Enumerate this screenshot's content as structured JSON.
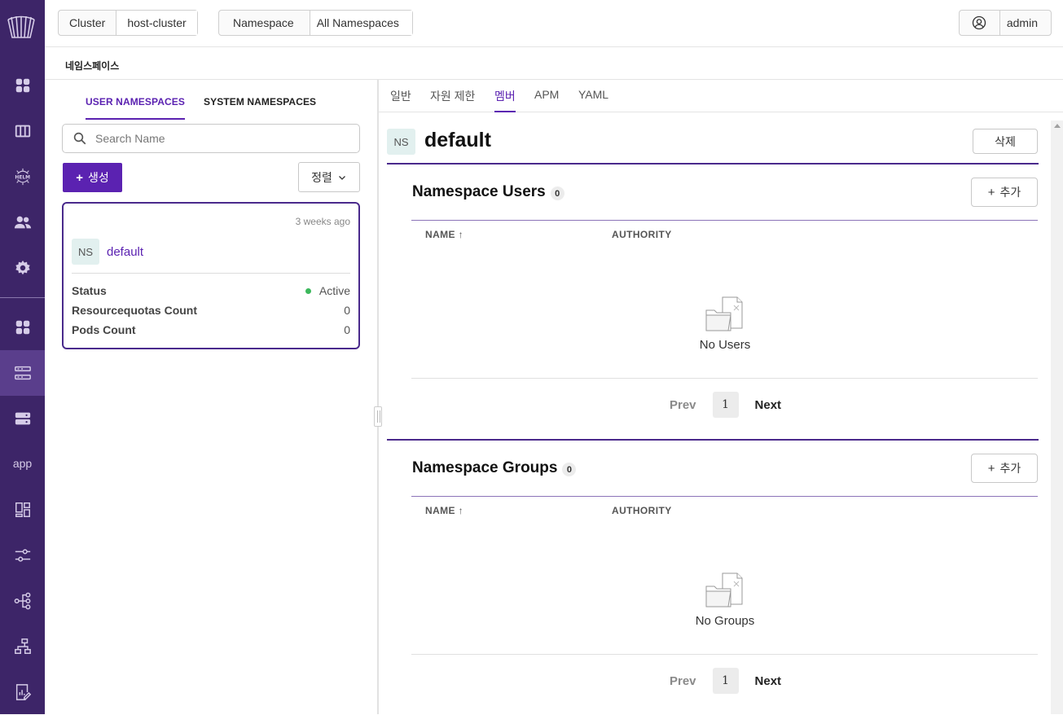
{
  "topbar": {
    "cluster_label": "Cluster",
    "cluster_value": "host-cluster",
    "namespace_label": "Namespace",
    "namespace_value": "All Namespaces",
    "user_name": "admin"
  },
  "breadcrumb": "네임스페이스",
  "left": {
    "tabs": [
      "USER NAMESPACES",
      "SYSTEM NAMESPACES"
    ],
    "active_tab": "USER NAMESPACES",
    "search_placeholder": "Search Name",
    "create_label": "생성",
    "sort_label": "정렬",
    "card": {
      "time": "3 weeks ago",
      "badge": "NS",
      "name": "default",
      "rows": [
        {
          "label": "Status",
          "value": "Active"
        },
        {
          "label": "Resourcequotas Count",
          "value": "0"
        },
        {
          "label": "Pods Count",
          "value": "0"
        }
      ]
    }
  },
  "detail": {
    "tabs": [
      "일반",
      "자원 제한",
      "멤버",
      "APM",
      "YAML"
    ],
    "active_tab": "멤버",
    "badge": "NS",
    "title": "default",
    "delete_label": "삭제",
    "users": {
      "title": "Namespace Users",
      "count": "0",
      "add_label": "추가",
      "columns": [
        "NAME",
        "AUTHORITY"
      ],
      "empty_text": "No Users",
      "prev": "Prev",
      "page": "1",
      "next": "Next"
    },
    "groups": {
      "title": "Namespace Groups",
      "count": "0",
      "add_label": "추가",
      "columns": [
        "NAME",
        "AUTHORITY"
      ],
      "empty_text": "No Groups",
      "prev": "Prev",
      "page": "1",
      "next": "Next"
    }
  },
  "sidebar": {
    "items": [
      "dashboard-icon",
      "columns-icon",
      "helm-icon",
      "users-icon",
      "settings-icon",
      "apps-grid-icon",
      "namespaces-icon",
      "storage-icon",
      "app",
      "workloads-icon",
      "config-icon",
      "network-icon",
      "topology-icon",
      "report-icon"
    ]
  },
  "colors": {
    "sidebar": "#3d2568",
    "accent": "#5b22b1",
    "status_active": "#3cb85c"
  }
}
